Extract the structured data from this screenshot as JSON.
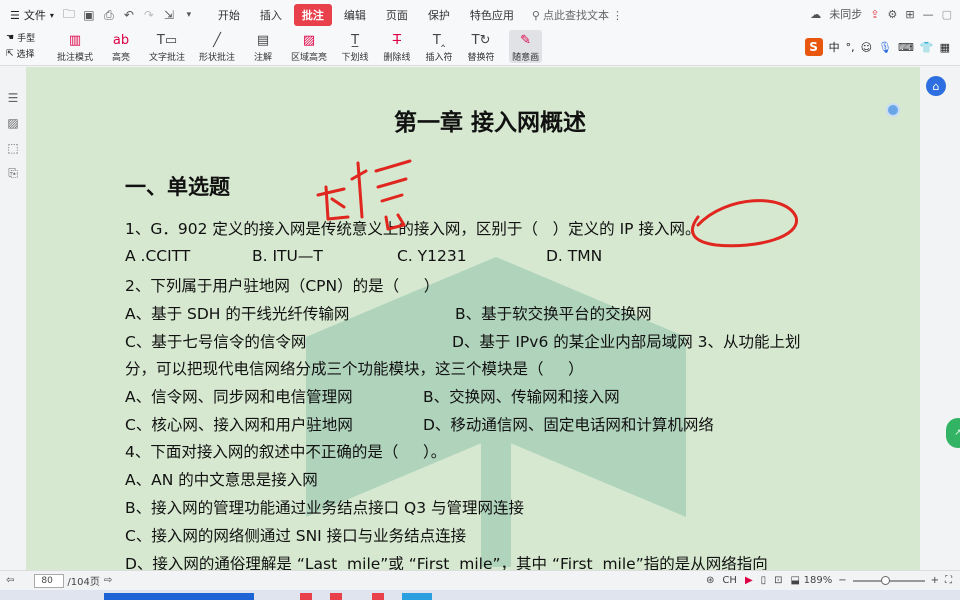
{
  "menubar": {
    "file_label": "文件",
    "tabs": [
      "开始",
      "插入",
      "批注",
      "编辑",
      "页面",
      "保护",
      "特色应用"
    ],
    "active_tab": "批注",
    "search_label": "点此查找文本",
    "sync_label": "未同步"
  },
  "ribbon": {
    "hand_tool": "手型",
    "select_tool": "选择",
    "buttons": [
      "批注模式",
      "高亮",
      "文字批注",
      "形状批注",
      "注解",
      "区域高亮",
      "下划线",
      "删除线",
      "插入符",
      "替换符",
      "随意画"
    ]
  },
  "wps_toolbar": {
    "ime": "中"
  },
  "document": {
    "title": "第一章  接入网概述",
    "section": "一、单选题",
    "q1": "1、G．902 定义的接入网是传统意义上的接入网，区别于（   ）定义的 IP 接入网。",
    "q1_opts": [
      "A .CCITT",
      "B. ITU—T",
      "C. Y1231",
      "D. TMN"
    ],
    "q2": "2、下列属于用户驻地网（CPN）的是（     ）",
    "q2_a": "A、基于 SDH 的干线光纤传输网",
    "q2_b": "B、基于软交换平台的交换网",
    "q2_c": "C、基于七号信令的信令网",
    "q2_d": "D、基于 IPv6 的某企业内部局域网 3、从功能上划",
    "q3_cont": "分，可以把现代电信网络分成三个功能模块，这三个模块是（     ）",
    "q3_a": "A、信令网、同步网和电信管理网",
    "q3_b": "B、交换网、传输网和接入网",
    "q3_c": "C、核心网、接入网和用户驻地网",
    "q3_d": "D、移动通信网、固定电话网和计算机网络",
    "q4": "4、下面对接入网的叙述中不正确的是（     ）。",
    "q4_a": "A、AN 的中文意思是接入网",
    "q4_b": "B、接入网的管理功能通过业务结点接口 Q3 与管理网连接",
    "q4_c": "C、接入网的网络侧通过 SNI 接口与业务结点连接",
    "q4_d": "D、接入网的通俗理解是 “Last  mile”或 “First  mile”，其中 “First  mile”指的是从网络指向"
  },
  "statusbar": {
    "page_current": "80",
    "page_total": "/104页",
    "lang": "CH",
    "zoom": "189%",
    "zoom_fraction": 0.45
  },
  "annotations": {
    "ink_color": "#e0261e"
  }
}
